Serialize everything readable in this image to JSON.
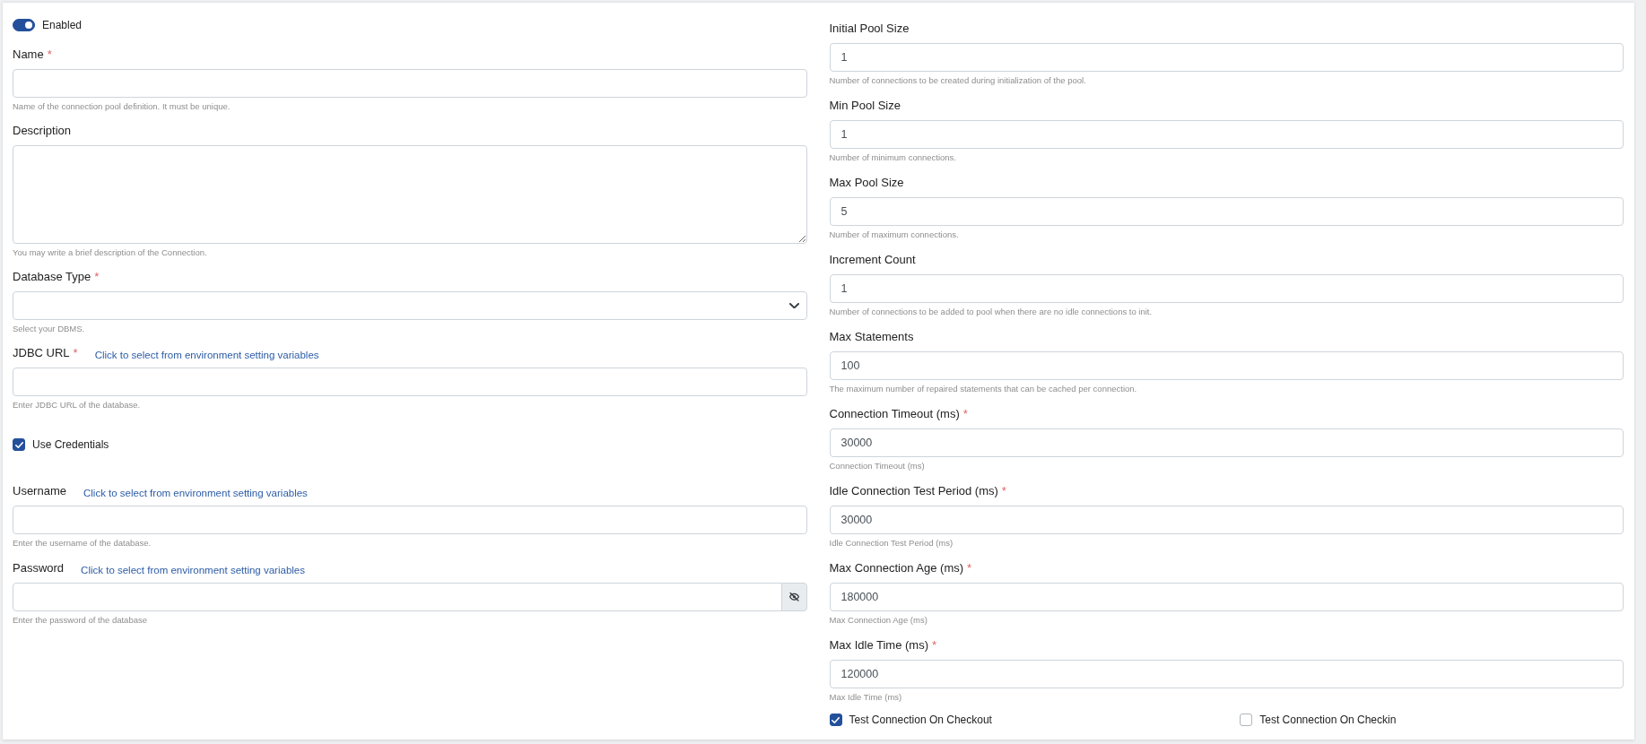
{
  "enabled": {
    "label": "Enabled",
    "on": true
  },
  "connection_fields": [
    {
      "kind": "text",
      "label": "Name",
      "required_mark": "*",
      "help": "Name of the connection pool definition. It must be unique."
    },
    {
      "kind": "textarea",
      "label": "Description",
      "help": "You may write a brief description of the Connection."
    },
    {
      "kind": "select",
      "label": "Database Type",
      "required_mark": "*",
      "help": "Select your DBMS."
    },
    {
      "kind": "text",
      "label": "JDBC URL",
      "required_mark": "*",
      "link": "Click to select from environment setting variables",
      "help": "Enter JDBC URL of the database."
    }
  ],
  "use_credentials": {
    "label": "Use Credentials",
    "checked": true
  },
  "credential_fields": [
    {
      "kind": "text",
      "label": "Username",
      "link": "Click to select from environment setting variables",
      "help": "Enter the username of the database."
    },
    {
      "kind": "password",
      "label": "Password",
      "link": "Click to select from environment setting variables",
      "help": "Enter the password of the database"
    }
  ],
  "pool_fields": [
    {
      "kind": "text",
      "label": "Initial Pool Size",
      "value": "1",
      "help": "Number of connections to be created during initialization of the pool."
    },
    {
      "kind": "text",
      "label": "Min Pool Size",
      "value": "1",
      "help": "Number of minimum connections."
    },
    {
      "kind": "text",
      "label": "Max Pool Size",
      "value": "5",
      "help": "Number of maximum connections."
    },
    {
      "kind": "text",
      "label": "Increment Count",
      "value": "1",
      "help": "Number of connections to be added to pool when there are no idle connections to init."
    },
    {
      "kind": "text",
      "label": "Max Statements",
      "value": "100",
      "help": "The maximum number of repaired statements that can be cached per connection."
    },
    {
      "kind": "text",
      "label": "Connection Timeout (ms)",
      "required_mark": "*",
      "value": "30000",
      "help": "Connection Timeout (ms)"
    },
    {
      "kind": "text",
      "label": "Idle Connection Test Period (ms)",
      "required_mark": "*",
      "value": "30000",
      "help": "Idle Connection Test Period (ms)"
    },
    {
      "kind": "text",
      "label": "Max Connection Age (ms)",
      "required_mark": "*",
      "value": "180000",
      "help": "Max Connection Age (ms)"
    },
    {
      "kind": "text",
      "label": "Max Idle Time (ms)",
      "required_mark": "*",
      "value": "120000",
      "help": "Max Idle Time (ms)"
    }
  ],
  "test_options": [
    {
      "label": "Test Connection On Checkout",
      "checked": true
    },
    {
      "label": "Test Connection On Checkin",
      "checked": false
    }
  ]
}
